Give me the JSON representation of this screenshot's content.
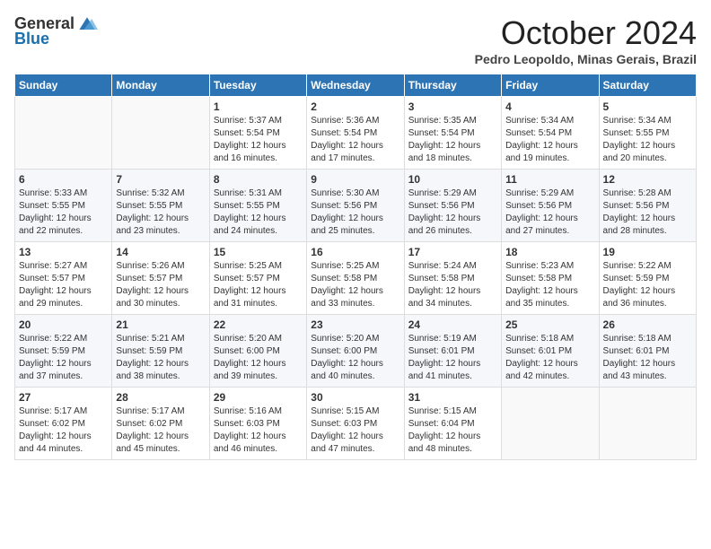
{
  "logo": {
    "general": "General",
    "blue": "Blue"
  },
  "title": "October 2024",
  "subtitle": "Pedro Leopoldo, Minas Gerais, Brazil",
  "headers": [
    "Sunday",
    "Monday",
    "Tuesday",
    "Wednesday",
    "Thursday",
    "Friday",
    "Saturday"
  ],
  "weeks": [
    [
      {
        "day": "",
        "info": ""
      },
      {
        "day": "",
        "info": ""
      },
      {
        "day": "1",
        "info": "Sunrise: 5:37 AM\nSunset: 5:54 PM\nDaylight: 12 hours and 16 minutes."
      },
      {
        "day": "2",
        "info": "Sunrise: 5:36 AM\nSunset: 5:54 PM\nDaylight: 12 hours and 17 minutes."
      },
      {
        "day": "3",
        "info": "Sunrise: 5:35 AM\nSunset: 5:54 PM\nDaylight: 12 hours and 18 minutes."
      },
      {
        "day": "4",
        "info": "Sunrise: 5:34 AM\nSunset: 5:54 PM\nDaylight: 12 hours and 19 minutes."
      },
      {
        "day": "5",
        "info": "Sunrise: 5:34 AM\nSunset: 5:55 PM\nDaylight: 12 hours and 20 minutes."
      }
    ],
    [
      {
        "day": "6",
        "info": "Sunrise: 5:33 AM\nSunset: 5:55 PM\nDaylight: 12 hours and 22 minutes."
      },
      {
        "day": "7",
        "info": "Sunrise: 5:32 AM\nSunset: 5:55 PM\nDaylight: 12 hours and 23 minutes."
      },
      {
        "day": "8",
        "info": "Sunrise: 5:31 AM\nSunset: 5:55 PM\nDaylight: 12 hours and 24 minutes."
      },
      {
        "day": "9",
        "info": "Sunrise: 5:30 AM\nSunset: 5:56 PM\nDaylight: 12 hours and 25 minutes."
      },
      {
        "day": "10",
        "info": "Sunrise: 5:29 AM\nSunset: 5:56 PM\nDaylight: 12 hours and 26 minutes."
      },
      {
        "day": "11",
        "info": "Sunrise: 5:29 AM\nSunset: 5:56 PM\nDaylight: 12 hours and 27 minutes."
      },
      {
        "day": "12",
        "info": "Sunrise: 5:28 AM\nSunset: 5:56 PM\nDaylight: 12 hours and 28 minutes."
      }
    ],
    [
      {
        "day": "13",
        "info": "Sunrise: 5:27 AM\nSunset: 5:57 PM\nDaylight: 12 hours and 29 minutes."
      },
      {
        "day": "14",
        "info": "Sunrise: 5:26 AM\nSunset: 5:57 PM\nDaylight: 12 hours and 30 minutes."
      },
      {
        "day": "15",
        "info": "Sunrise: 5:25 AM\nSunset: 5:57 PM\nDaylight: 12 hours and 31 minutes."
      },
      {
        "day": "16",
        "info": "Sunrise: 5:25 AM\nSunset: 5:58 PM\nDaylight: 12 hours and 33 minutes."
      },
      {
        "day": "17",
        "info": "Sunrise: 5:24 AM\nSunset: 5:58 PM\nDaylight: 12 hours and 34 minutes."
      },
      {
        "day": "18",
        "info": "Sunrise: 5:23 AM\nSunset: 5:58 PM\nDaylight: 12 hours and 35 minutes."
      },
      {
        "day": "19",
        "info": "Sunrise: 5:22 AM\nSunset: 5:59 PM\nDaylight: 12 hours and 36 minutes."
      }
    ],
    [
      {
        "day": "20",
        "info": "Sunrise: 5:22 AM\nSunset: 5:59 PM\nDaylight: 12 hours and 37 minutes."
      },
      {
        "day": "21",
        "info": "Sunrise: 5:21 AM\nSunset: 5:59 PM\nDaylight: 12 hours and 38 minutes."
      },
      {
        "day": "22",
        "info": "Sunrise: 5:20 AM\nSunset: 6:00 PM\nDaylight: 12 hours and 39 minutes."
      },
      {
        "day": "23",
        "info": "Sunrise: 5:20 AM\nSunset: 6:00 PM\nDaylight: 12 hours and 40 minutes."
      },
      {
        "day": "24",
        "info": "Sunrise: 5:19 AM\nSunset: 6:01 PM\nDaylight: 12 hours and 41 minutes."
      },
      {
        "day": "25",
        "info": "Sunrise: 5:18 AM\nSunset: 6:01 PM\nDaylight: 12 hours and 42 minutes."
      },
      {
        "day": "26",
        "info": "Sunrise: 5:18 AM\nSunset: 6:01 PM\nDaylight: 12 hours and 43 minutes."
      }
    ],
    [
      {
        "day": "27",
        "info": "Sunrise: 5:17 AM\nSunset: 6:02 PM\nDaylight: 12 hours and 44 minutes."
      },
      {
        "day": "28",
        "info": "Sunrise: 5:17 AM\nSunset: 6:02 PM\nDaylight: 12 hours and 45 minutes."
      },
      {
        "day": "29",
        "info": "Sunrise: 5:16 AM\nSunset: 6:03 PM\nDaylight: 12 hours and 46 minutes."
      },
      {
        "day": "30",
        "info": "Sunrise: 5:15 AM\nSunset: 6:03 PM\nDaylight: 12 hours and 47 minutes."
      },
      {
        "day": "31",
        "info": "Sunrise: 5:15 AM\nSunset: 6:04 PM\nDaylight: 12 hours and 48 minutes."
      },
      {
        "day": "",
        "info": ""
      },
      {
        "day": "",
        "info": ""
      }
    ]
  ]
}
